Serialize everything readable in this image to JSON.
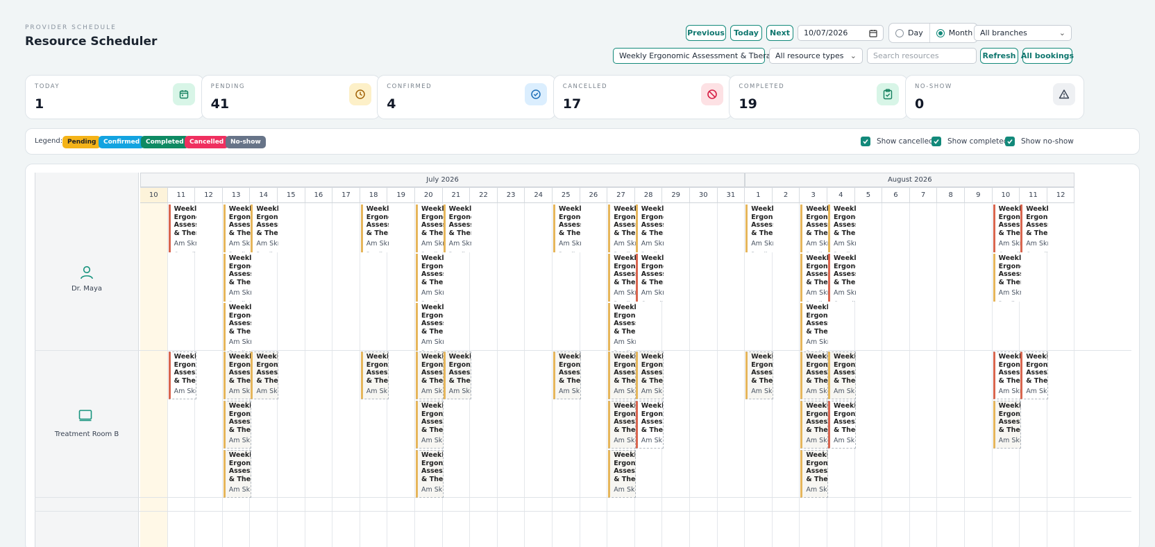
{
  "header": {
    "eyebrow": "PROVIDER SCHEDULE",
    "title": "Resource Scheduler"
  },
  "toolbar": {
    "previous": "Previous",
    "today": "Today",
    "next": "Next",
    "date": "10/07/2026",
    "view_day": "Day",
    "view_month": "Month",
    "view_selected": "Month",
    "branch": "All branches",
    "service": "Weekly Ergonomic Assessment & Therapy",
    "resource_type": "All resource types",
    "search_placeholder": "Search resources",
    "refresh": "Refresh",
    "all_bookings": "All bookings"
  },
  "stats": [
    {
      "label": "TODAY",
      "value": "1",
      "icon": "calendar-icon",
      "tint": "#d8f5e7",
      "color": "#15805f"
    },
    {
      "label": "PENDING",
      "value": "41",
      "icon": "clock-icon",
      "tint": "#fdf0c8",
      "color": "#a16207"
    },
    {
      "label": "CONFIRMED",
      "value": "4",
      "icon": "check-circle-icon",
      "tint": "#dbeefe",
      "color": "#1d6fb8"
    },
    {
      "label": "CANCELLED",
      "value": "17",
      "icon": "ban-icon",
      "tint": "#fde1e4",
      "color": "#d61f45"
    },
    {
      "label": "COMPLETED",
      "value": "19",
      "icon": "clipboard-check-icon",
      "tint": "#d8f5e7",
      "color": "#15805f"
    },
    {
      "label": "NO-SHOW",
      "value": "0",
      "icon": "alert-triangle-icon",
      "tint": "#eef0f3",
      "color": "#374151"
    }
  ],
  "legend": {
    "label": "Legend:",
    "items": [
      {
        "label": "Pending",
        "color": "#f4b318"
      },
      {
        "label": "Confirmed",
        "color": "#13a3e0"
      },
      {
        "label": "Completed",
        "color": "#0e8a63"
      },
      {
        "label": "Cancelled",
        "color": "#ef2f5f"
      },
      {
        "label": "No-show",
        "color": "#677488"
      }
    ],
    "toggles": [
      "Show cancelled",
      "Show completed",
      "Show no-show"
    ]
  },
  "calendar": {
    "months": [
      {
        "label": "July 2026"
      },
      {
        "label": "August 2026"
      }
    ],
    "days": [
      "10",
      "11",
      "12",
      "13",
      "14",
      "15",
      "16",
      "17",
      "18",
      "19",
      "20",
      "21",
      "22",
      "23",
      "24",
      "25",
      "26",
      "27",
      "28",
      "29",
      "30",
      "31",
      "1",
      "2",
      "3",
      "4",
      "5",
      "6",
      "7",
      "8",
      "9",
      "10",
      "11",
      "12"
    ],
    "resources": [
      {
        "name": "Dr. Maya",
        "icon": "user-icon"
      },
      {
        "name": "Treatment Room B",
        "icon": "room-icon"
      }
    ],
    "event": {
      "title1": "Weekly",
      "title2": "Ergonomic",
      "title3": "Assessment",
      "title4": "& Therapy",
      "subtitle": "Am Skraeling",
      "pending": "Pending",
      "cancelled": "Cancelled"
    }
  }
}
